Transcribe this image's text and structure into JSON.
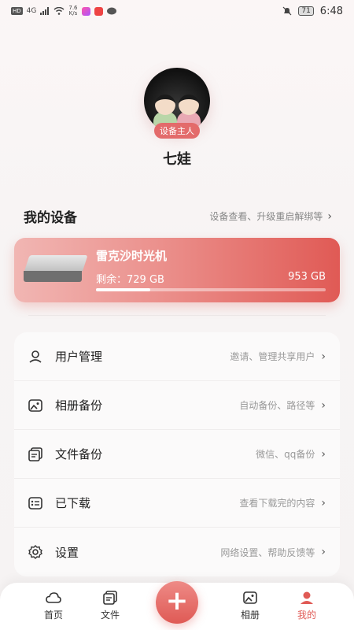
{
  "status_bar": {
    "sim_label": "HD",
    "network_label": "4G",
    "speed_value": "7.6",
    "speed_unit": "K/s",
    "battery": "71",
    "time": "6:48"
  },
  "profile": {
    "badge": "设备主人",
    "username": "七娃"
  },
  "devices_section": {
    "title": "我的设备",
    "link": "设备查看、升级重启解绑等"
  },
  "device": {
    "name": "雷克沙时光机",
    "remaining": "剩余：729 GB",
    "total": "953 GB",
    "used_fraction": 0.235
  },
  "menu": [
    {
      "label": "用户管理",
      "desc": "邀请、管理共享用户",
      "icon": "user-icon"
    },
    {
      "label": "相册备份",
      "desc": "自动备份、路径等",
      "icon": "photo-icon"
    },
    {
      "label": "文件备份",
      "desc": "微信、qq备份",
      "icon": "files-icon"
    },
    {
      "label": "已下载",
      "desc": "查看下载完的内容",
      "icon": "download-list-icon"
    },
    {
      "label": "设置",
      "desc": "网络设置、帮助反馈等",
      "icon": "gear-icon"
    }
  ],
  "nav": {
    "home": "首页",
    "files": "文件",
    "add": "+",
    "album": "相册",
    "mine": "我的"
  },
  "colors": {
    "accent": "#e05a55",
    "card_start": "#f1b6b3",
    "card_end": "#e05a55"
  }
}
